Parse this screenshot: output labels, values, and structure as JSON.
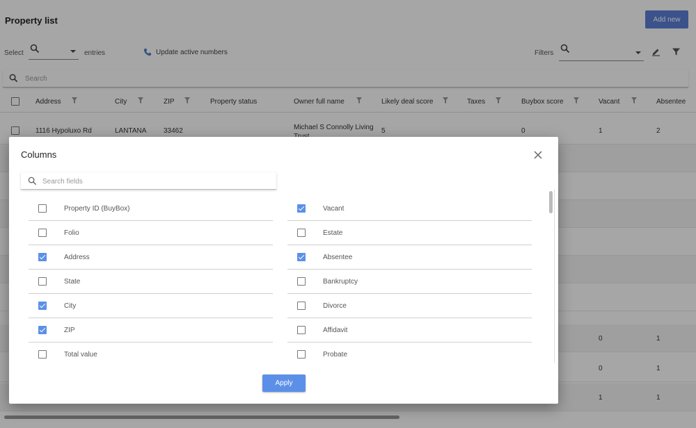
{
  "page": {
    "title": "Property list",
    "add_new_label": "Add new",
    "select_label": "Select",
    "entries_label": "entries",
    "update_numbers_label": "Update active numbers",
    "filters_label": "Filters",
    "search_placeholder": "Search"
  },
  "table": {
    "columns": [
      "Address",
      "City",
      "ZIP",
      "Property status",
      "Owner full name",
      "Likely deal score",
      "Taxes",
      "Buybox score",
      "Vacant",
      "Absentee"
    ],
    "first_row": {
      "address": "1116 Hypoluxo Rd",
      "city": "LANTANA",
      "zip": "33462",
      "owner": "Michael S Connolly Living Trust",
      "likely_deal_score": "5",
      "buybox_score": "0",
      "vacant": "1",
      "absentee": "2"
    },
    "partial_rows": [
      {
        "vacant": "0",
        "absentee": "1"
      },
      {
        "vacant": "0",
        "absentee": "1"
      },
      {
        "vacant": "1",
        "absentee": "1"
      }
    ]
  },
  "modal": {
    "title": "Columns",
    "search_placeholder": "Search fields",
    "apply_label": "Apply",
    "left_fields": [
      {
        "label": "Property ID (BuyBox)",
        "checked": false
      },
      {
        "label": "Folio",
        "checked": false
      },
      {
        "label": "Address",
        "checked": true
      },
      {
        "label": "State",
        "checked": false
      },
      {
        "label": "City",
        "checked": true
      },
      {
        "label": "ZIP",
        "checked": true
      },
      {
        "label": "Total value",
        "checked": false
      }
    ],
    "right_fields": [
      {
        "label": "Vacant",
        "checked": true
      },
      {
        "label": "Estate",
        "checked": false
      },
      {
        "label": "Absentee",
        "checked": true
      },
      {
        "label": "Bankruptcy",
        "checked": false
      },
      {
        "label": "Divorce",
        "checked": false
      },
      {
        "label": "Affidavit",
        "checked": false
      },
      {
        "label": "Probate",
        "checked": false
      }
    ]
  },
  "colors": {
    "accent": "#5c90e8",
    "add_button": "#5b7fd6",
    "overlay": "rgba(0,0,0,0.35)"
  },
  "icons": [
    "search-icon",
    "chevron-down-icon",
    "phone-icon",
    "edit-icon",
    "filter-icon",
    "close-icon",
    "checkbox-icon"
  ]
}
